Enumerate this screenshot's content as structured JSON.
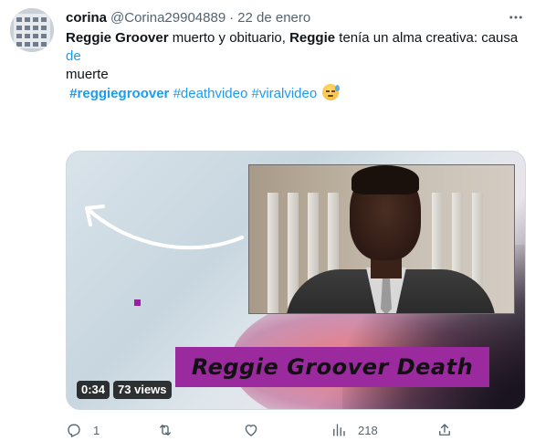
{
  "tweet": {
    "author_name": "corina",
    "handle": "@Corina29904889",
    "separator": "·",
    "date": "22 de enero",
    "text_segments": {
      "s1_bold": "Reggie Groover",
      "s2": " muerto y obituario, ",
      "s3_bold": "Reggie",
      "s4": " tenía un alma creativa: causa ",
      "s5_link": "de",
      "s6": "muerte"
    },
    "hashtags": [
      "#reggiegroover",
      "#deathvideo",
      "#viralvideo"
    ],
    "emoji": "downcast-sweat-face-emoji"
  },
  "media": {
    "title_text": "Reggie Groover Death",
    "duration": "0:34",
    "views": "73 views",
    "banner_color": "#9b2a9f",
    "accent_square_color": "#9b1fa3"
  },
  "actions": {
    "reply_count": "1",
    "retweet_count": "",
    "like_count": "",
    "view_count": "218"
  },
  "colors": {
    "link": "#1d9bf0",
    "muted": "#536471",
    "text": "#0f1419"
  }
}
